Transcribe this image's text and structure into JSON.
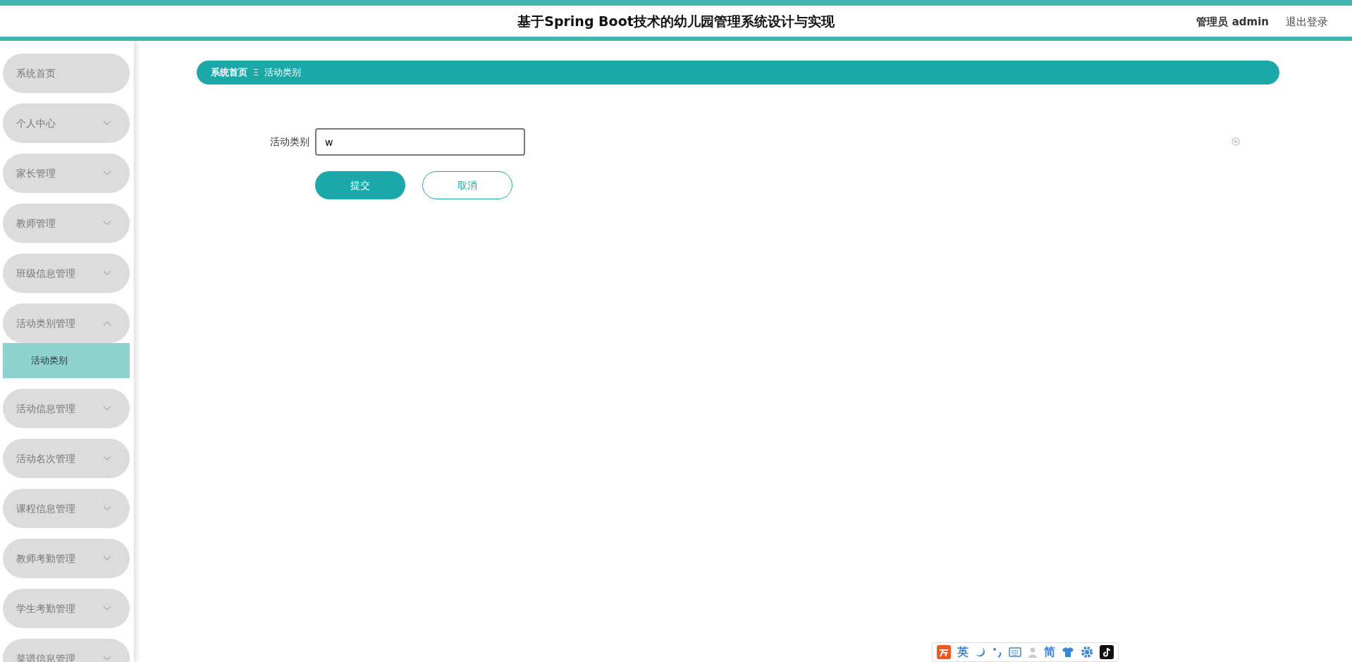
{
  "header": {
    "title": "基于Spring Boot技术的幼儿园管理系统设计与实现",
    "user": "管理员 admin",
    "logout": "退出登录"
  },
  "sidebar": {
    "items": [
      {
        "label": "系统首页",
        "kind": "link"
      },
      {
        "label": "个人中心",
        "kind": "menu",
        "expanded": false
      },
      {
        "label": "家长管理",
        "kind": "menu",
        "expanded": false
      },
      {
        "label": "教师管理",
        "kind": "menu",
        "expanded": false
      },
      {
        "label": "班级信息管理",
        "kind": "menu",
        "expanded": false
      },
      {
        "label": "活动类别管理",
        "kind": "menu",
        "expanded": true,
        "children": [
          {
            "label": "活动类别",
            "selected": true
          }
        ]
      },
      {
        "label": "活动信息管理",
        "kind": "menu",
        "expanded": false
      },
      {
        "label": "活动名次管理",
        "kind": "menu",
        "expanded": false
      },
      {
        "label": "课程信息管理",
        "kind": "menu",
        "expanded": false
      },
      {
        "label": "教师考勤管理",
        "kind": "menu",
        "expanded": false
      },
      {
        "label": "学生考勤管理",
        "kind": "menu",
        "expanded": false
      },
      {
        "label": "菜谱信息管理",
        "kind": "menu",
        "expanded": false
      }
    ]
  },
  "breadcrumb": {
    "home": "系统首页",
    "separator": "Ξ",
    "current": "活动类别"
  },
  "form": {
    "fields": [
      {
        "label": "活动类别",
        "value": "w"
      }
    ],
    "submit": "提交",
    "cancel": "取消"
  },
  "ime_toolbar": {
    "items": [
      {
        "kind": "logo"
      },
      {
        "kind": "text",
        "text": "英"
      },
      {
        "kind": "moon"
      },
      {
        "kind": "punct"
      },
      {
        "kind": "keyboard"
      },
      {
        "kind": "user"
      },
      {
        "kind": "text",
        "text": "简"
      },
      {
        "kind": "shirt"
      },
      {
        "kind": "gear"
      },
      {
        "kind": "note"
      }
    ]
  }
}
